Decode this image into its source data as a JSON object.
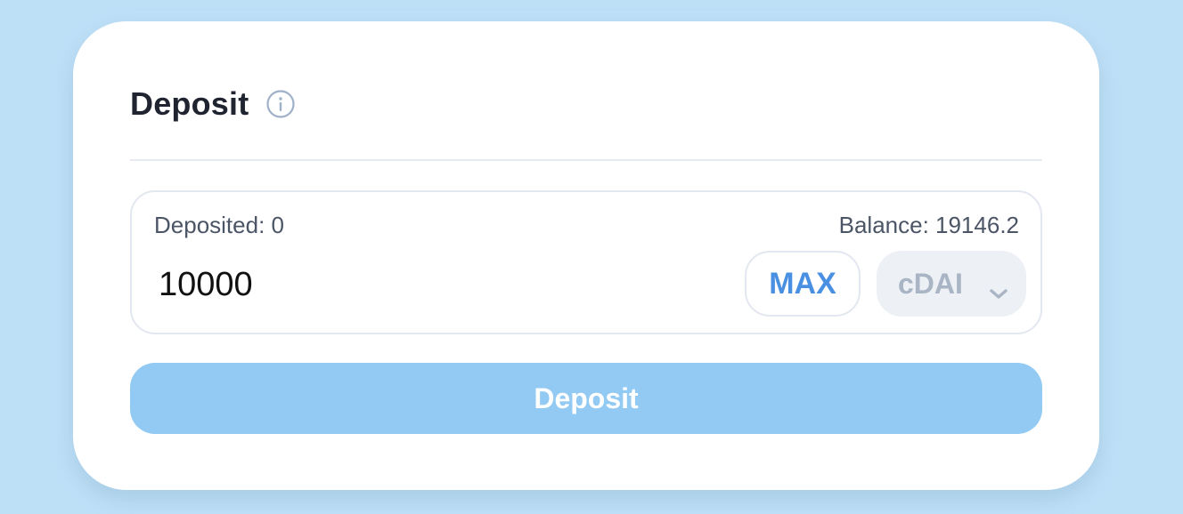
{
  "header": {
    "title": "Deposit",
    "info_icon": "info-icon"
  },
  "panel": {
    "deposited_text": "Deposited: 0",
    "balance_text": "Balance: 19146.2",
    "amount_value": "10000",
    "max_label": "MAX",
    "token": {
      "selected": "cDAI",
      "icon": "chevron-down-icon"
    }
  },
  "action": {
    "deposit_label": "Deposit"
  },
  "colors": {
    "page_background": "#bee0f7",
    "accent": "#4a90e2",
    "button_disabled": "#93caf3"
  }
}
